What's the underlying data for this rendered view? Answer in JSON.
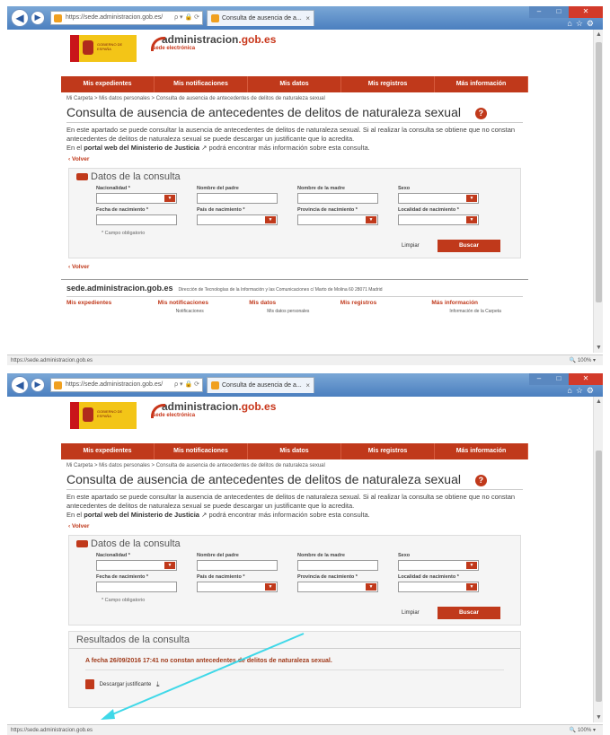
{
  "browser": {
    "address": "https://sede.administracion.gob.es/",
    "address_controls": "ρ ▾ 🔒 ⟳",
    "tab_title": "Consulta de ausencia de a...",
    "tab_close": "×",
    "status_url": "https://sede.administracion.gob.es",
    "zoom": "100%",
    "back_icon": "arrow-left",
    "forward_icon": "arrow-right"
  },
  "site": {
    "government_logo_text": "GOBIERNO DE ESPAÑA",
    "brand_name_part1": "administracion",
    "brand_name_part2": ".gob.es",
    "brand_sub": "sede electrónica",
    "menu": [
      "Mis expedientes",
      "Mis notificaciones",
      "Mis datos",
      "Mis registros",
      "Más información"
    ],
    "breadcrumb": "Mi Carpeta > Mis datos personales > Consulta de ausencia de antecedentes de delitos de naturaleza sexual",
    "page_title": "Consulta de ausencia de antecedentes de delitos de naturaleza sexual",
    "help_label": "?",
    "desc_line1": "En este apartado se puede consultar la ausencia de antecedentes de delitos de naturaleza sexual. Si al realizar la consulta se obtiene que no constan antecedentes de delitos de naturaleza sexual se puede descargar un justificante que lo acredita.",
    "desc_prefix": "En el",
    "desc_link": "portal web del Ministerio de Justicia",
    "desc_suffix": "podrá encontrar más información sobre esta consulta.",
    "back_label": "Volver",
    "form_title": "Datos de la consulta",
    "fields": {
      "nacionalidad": "Nacionalidad *",
      "padre": "Nombre del padre",
      "madre": "Nombre de la madre",
      "sexo": "Sexo",
      "fecha": "Fecha de nacimiento *",
      "pais": "País de nacimiento *",
      "provincia": "Provincia de nacimiento *",
      "localidad": "Localidad de nacimiento *"
    },
    "required_note": "* Campo obligatorio",
    "clear_label": "Limpiar",
    "search_label": "Buscar",
    "footer_site": "sede.administracion.gob.es",
    "footer_address": "Dirección de Tecnologías de la Información y las Comunicaciones c/ Marto de Molina 60 28071 Madrid",
    "footer_menu": [
      "Mis expedientes",
      "Mis notificaciones",
      "Mis datos",
      "Mis registros",
      "Más información"
    ],
    "footer_sub": [
      "",
      "Notificaciones",
      "Mis datos personales",
      "",
      "Información de la Carpeta"
    ],
    "results_title": "Resultados de la consulta",
    "result_message": "A fecha 26/09/2016 17:41 no constan antecedentes de delitos de naturaleza sexual.",
    "download_label": "Descargar justificante"
  },
  "colors": {
    "brand_red": "#c0391b",
    "arrow": "#3fd8e8"
  }
}
